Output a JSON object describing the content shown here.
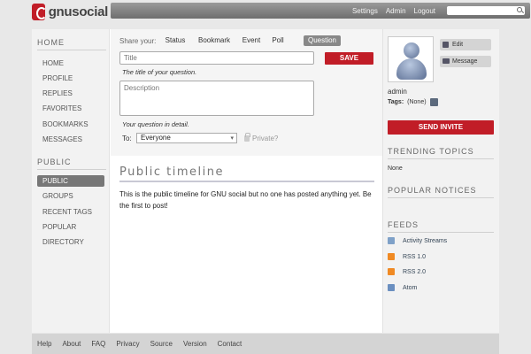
{
  "logo": {
    "text": "gnusocial"
  },
  "topnav": {
    "settings": "Settings",
    "admin": "Admin",
    "logout": "Logout",
    "search_placeholder": ""
  },
  "leftnav": {
    "home_heading": "HOME",
    "home_items": [
      "HOME",
      "PROFILE",
      "REPLIES",
      "FAVORITES",
      "BOOKMARKS",
      "MESSAGES"
    ],
    "public_heading": "PUBLIC",
    "public_items": [
      "PUBLIC",
      "GROUPS",
      "RECENT TAGS",
      "POPULAR",
      "DIRECTORY"
    ]
  },
  "form": {
    "share_label": "Share your:",
    "tabs": [
      "Status",
      "Bookmark",
      "Event",
      "Poll",
      "Question"
    ],
    "title_placeholder": "Title",
    "title_hint": "The title of your question.",
    "save_label": "SAVE",
    "desc_placeholder": "Description",
    "desc_hint": "Your question in detail.",
    "to_label": "To:",
    "to_value": "Everyone",
    "private_label": "Private?"
  },
  "timeline": {
    "title": "Public timeline",
    "empty_text": "This is the public timeline for GNU social but no one has posted anything yet. Be the first to post!"
  },
  "profile": {
    "edit_label": "Edit",
    "message_label": "Message",
    "username": "admin",
    "tags_label": "Tags:",
    "tags_value": "(None)",
    "invite_label": "SEND INVITE"
  },
  "sidebar": {
    "trending_heading": "TRENDING TOPICS",
    "trending_value": "None",
    "popular_heading": "POPULAR NOTICES",
    "feeds_heading": "FEEDS",
    "feeds": [
      "Activity Streams",
      "RSS 1.0",
      "RSS 2.0",
      "Atom"
    ]
  },
  "footer": {
    "links": [
      "Help",
      "About",
      "FAQ",
      "Privacy",
      "Source",
      "Version",
      "Contact"
    ]
  },
  "colors": {
    "accent": "#c11d27",
    "topbar": "#7a7a7a",
    "active_nav": "#777777"
  }
}
